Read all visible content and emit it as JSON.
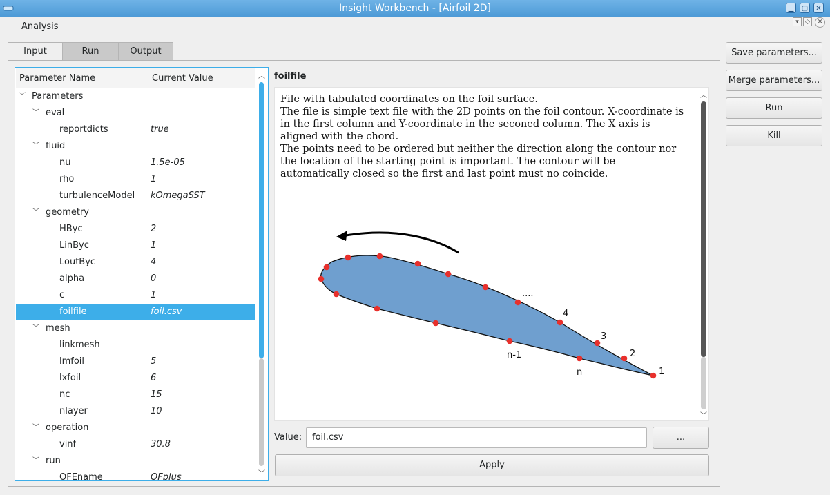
{
  "window": {
    "title": "Insight Workbench - [Airfoil 2D]"
  },
  "menubar": {
    "analysis": "Analysis"
  },
  "tabs": [
    {
      "label": "Input",
      "active": true
    },
    {
      "label": "Run",
      "active": false
    },
    {
      "label": "Output",
      "active": false
    }
  ],
  "tree": {
    "headers": {
      "name": "Parameter Name",
      "value": "Current Value"
    },
    "rows": [
      {
        "label": "Parameters",
        "value": "",
        "depth": 0,
        "expanded": true
      },
      {
        "label": "eval",
        "value": "",
        "depth": 1,
        "expanded": true
      },
      {
        "label": "reportdicts",
        "value": "true",
        "depth": 2
      },
      {
        "label": "fluid",
        "value": "",
        "depth": 1,
        "expanded": true
      },
      {
        "label": "nu",
        "value": "1.5e-05",
        "depth": 2
      },
      {
        "label": "rho",
        "value": "1",
        "depth": 2
      },
      {
        "label": "turbulenceModel",
        "value": "kOmegaSST",
        "depth": 2
      },
      {
        "label": "geometry",
        "value": "",
        "depth": 1,
        "expanded": true
      },
      {
        "label": "HByc",
        "value": "2",
        "depth": 2
      },
      {
        "label": "LinByc",
        "value": "1",
        "depth": 2
      },
      {
        "label": "LoutByc",
        "value": "4",
        "depth": 2
      },
      {
        "label": "alpha",
        "value": "0",
        "depth": 2
      },
      {
        "label": "c",
        "value": "1",
        "depth": 2
      },
      {
        "label": "foilfile",
        "value": "foil.csv",
        "depth": 2,
        "selected": true
      },
      {
        "label": "mesh",
        "value": "",
        "depth": 1,
        "expanded": true
      },
      {
        "label": "linkmesh",
        "value": "",
        "depth": 2
      },
      {
        "label": "lmfoil",
        "value": "5",
        "depth": 2
      },
      {
        "label": "lxfoil",
        "value": "6",
        "depth": 2
      },
      {
        "label": "nc",
        "value": "15",
        "depth": 2
      },
      {
        "label": "nlayer",
        "value": "10",
        "depth": 2
      },
      {
        "label": "operation",
        "value": "",
        "depth": 1,
        "expanded": true
      },
      {
        "label": "vinf",
        "value": "30.8",
        "depth": 2
      },
      {
        "label": "run",
        "value": "",
        "depth": 1,
        "expanded": true
      },
      {
        "label": "OFEname",
        "value": "OFplus",
        "depth": 2
      }
    ]
  },
  "detail": {
    "param_name": "foilfile",
    "description": [
      "File with tabulated coordinates on the foil surface.",
      "The file is simple text file with the 2D points on the foil contour. X-coordinate is in the first column and Y-coordinate in the seconed column. The X axis is aligned with the chord.",
      "The points need to be ordered but neither the direction along the contour nor the location of the starting point is important. The contour will be automatically closed so the first and last point must no coincide."
    ],
    "diagram_labels": {
      "dots": "....",
      "p4": "4",
      "p3": "3",
      "p2": "2",
      "p1": "1",
      "pn": "n",
      "pn1": "n-1"
    },
    "value_label": "Value:",
    "value": "foil.csv",
    "browse": "...",
    "apply": "Apply"
  },
  "side_buttons": {
    "save": "Save parameters...",
    "merge": "Merge parameters...",
    "run": "Run",
    "kill": "Kill"
  },
  "colors": {
    "accent": "#3daee9",
    "foil_fill": "#6f9fcf",
    "point": "#e8302c"
  }
}
